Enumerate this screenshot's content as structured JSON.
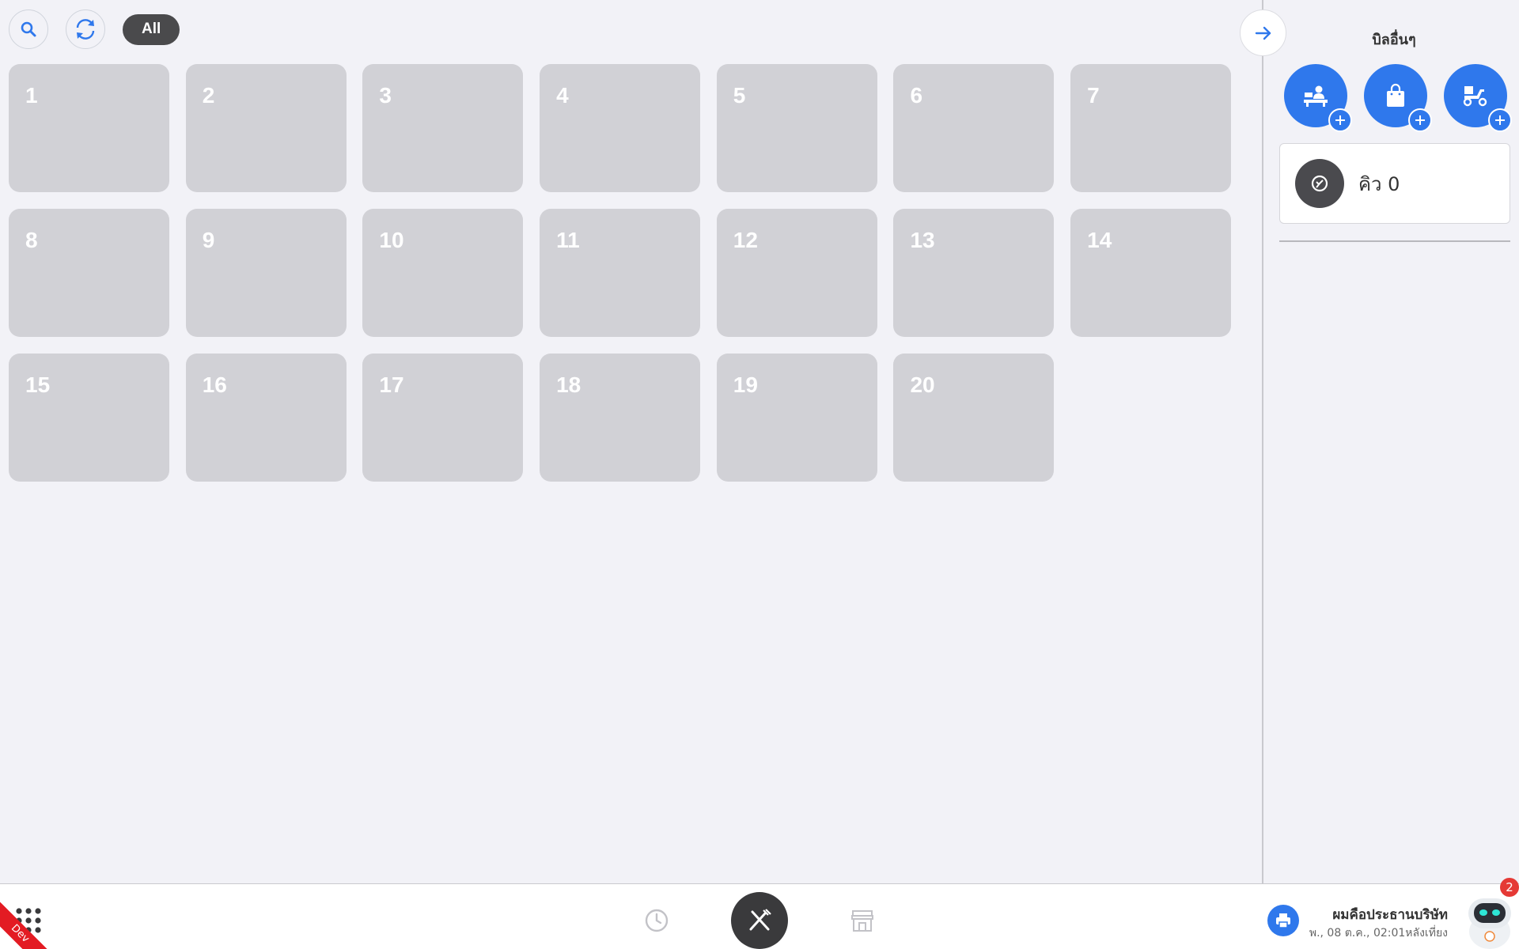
{
  "toolbar": {
    "search_icon": "search-icon",
    "refresh_icon": "refresh-icon",
    "filter_label": "All"
  },
  "tables": [
    "1",
    "2",
    "3",
    "4",
    "5",
    "6",
    "7",
    "8",
    "9",
    "10",
    "11",
    "12",
    "13",
    "14",
    "15",
    "16",
    "17",
    "18",
    "19",
    "20"
  ],
  "right_panel": {
    "title": "บิลอื่นๆ",
    "bill_types": [
      {
        "icon": "dine-in-counter-icon"
      },
      {
        "icon": "takeaway-bag-icon"
      },
      {
        "icon": "delivery-scooter-icon"
      }
    ],
    "queue": {
      "label": "คิว 0",
      "icon": "queue-icon"
    }
  },
  "bottom_bar": {
    "dev_label": "Dev",
    "user_name": "ผมคือประธานบริษัท",
    "datetime": "พ., 08 ต.ค., 02:01หลังเที่ยง",
    "notification_count": "2"
  },
  "colors": {
    "accent": "#2f78ec",
    "card": "#d1d1d6",
    "background": "#f2f2f7",
    "chip": "#4a4a4c",
    "badge": "#e53935"
  }
}
